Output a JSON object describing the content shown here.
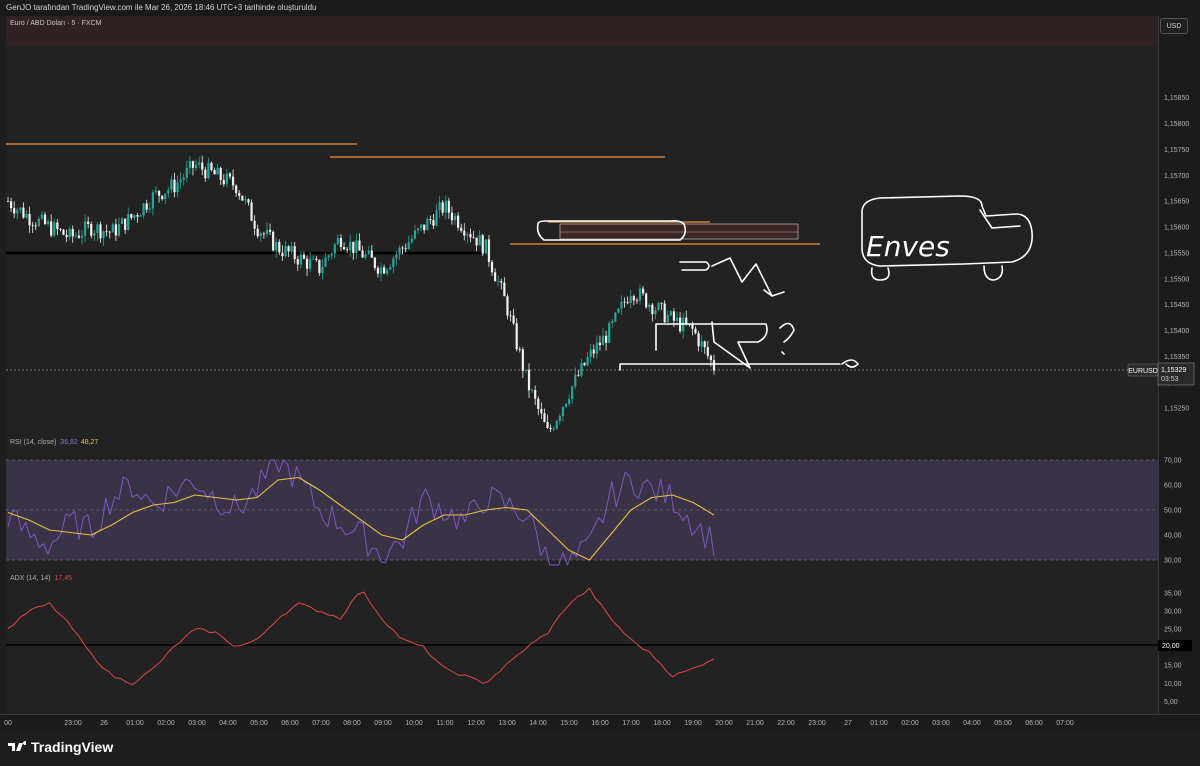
{
  "header": {
    "attribution": "GenJO tarafından TradingView.com ile Mar 26, 2026 18:46 UTC+3 tarihinde oluşturuldu",
    "symbol_title": "Euro / ABD Doları · 5 · FXCM",
    "currency": "USD"
  },
  "price_badge": {
    "symbol": "EURUSD",
    "price": "1,15329",
    "countdown": "03:53"
  },
  "annotation_text": "Enves",
  "indicators": {
    "rsi": {
      "name": "RSI (14, close)",
      "value": "36,82",
      "ma_value": "48,27"
    },
    "adx": {
      "name": "ADX (14, 14)",
      "value": "17,45",
      "level_label": "20,00"
    }
  },
  "brand": {
    "name": "TradingView"
  },
  "colors": {
    "bull": "#26a69a",
    "bear": "#f0f0f0",
    "resistance": "#f5913a",
    "rsi": "#7e57c2",
    "rsi_ma": "#e8c145",
    "adx": "#e04848",
    "rsi_band": "#3a3347"
  },
  "chart_data": [
    {
      "type": "candlestick",
      "title": "Euro / ABD Doları · 5 · FXCM",
      "ylim": [
        1.152,
        1.1595
      ],
      "y_ticks": [
        "1,15850",
        "1,15800",
        "1,15750",
        "1,15700",
        "1,15650",
        "1,15600",
        "1,15550",
        "1,15500",
        "1,15450",
        "1,15400",
        "1,15350",
        "1,15300",
        "1,15250"
      ],
      "x_ticks": [
        "00",
        "23:00",
        "26",
        "01:00",
        "02:00",
        "03:00",
        "04:00",
        "05:00",
        "06:00",
        "07:00",
        "08:00",
        "09:00",
        "10:00",
        "11:00",
        "12:00",
        "13:00",
        "14:00",
        "15:00",
        "16:00",
        "17:00",
        "18:00",
        "19:00",
        "20:00",
        "21:00",
        "22:00",
        "23:00",
        "27",
        "01:00",
        "02:00",
        "03:00",
        "04:00",
        "05:00",
        "06:00",
        "07:00"
      ],
      "close_path": [
        1.1565,
        1.1562,
        1.156,
        1.1558,
        1.156,
        1.1559,
        1.1562,
        1.1566,
        1.1568,
        1.1572,
        1.157,
        1.1568,
        1.156,
        1.1556,
        1.1554,
        1.1552,
        1.1558,
        1.1555,
        1.1552,
        1.1556,
        1.156,
        1.1564,
        1.156,
        1.1556,
        1.1545,
        1.153,
        1.152,
        1.1528,
        1.1535,
        1.154,
        1.1548,
        1.1545,
        1.1542,
        1.154,
        1.1533
      ],
      "last_price": 1.15329,
      "levels": [
        1.15704,
        1.15685,
        1.15525,
        1.15535,
        1.1557
      ]
    },
    {
      "type": "line",
      "title": "RSI (14, close)",
      "ylim": [
        25,
        75
      ],
      "y_ticks": [
        "70,00",
        "60,00",
        "50,00",
        "40,00",
        "30,00"
      ],
      "series": [
        {
          "name": "RSI",
          "values": [
            48,
            40,
            36,
            45,
            42,
            55,
            60,
            52,
            58,
            62,
            55,
            50,
            58,
            70,
            62,
            50,
            45,
            40,
            32,
            38,
            55,
            50,
            45,
            55,
            52,
            48,
            30,
            28,
            35,
            55,
            62,
            58,
            55,
            45,
            37
          ]
        },
        {
          "name": "MA",
          "values": [
            49,
            46,
            42,
            41,
            40,
            44,
            49,
            52,
            53,
            56,
            55,
            54,
            55,
            62,
            63,
            58,
            52,
            46,
            40,
            38,
            44,
            48,
            48,
            50,
            51,
            50,
            42,
            34,
            30,
            40,
            50,
            55,
            56,
            53,
            48
          ]
        }
      ]
    },
    {
      "type": "line",
      "title": "ADX (14, 14)",
      "ylim": [
        2,
        38
      ],
      "y_ticks": [
        "35,00",
        "30,00",
        "25,00",
        "20,00",
        "15,00",
        "10,00",
        "5,00"
      ],
      "series": [
        {
          "name": "ADX",
          "values": [
            25,
            30,
            32,
            26,
            18,
            12,
            10,
            14,
            20,
            25,
            24,
            20,
            22,
            28,
            32,
            30,
            28,
            36,
            28,
            22,
            20,
            14,
            12,
            10,
            15,
            20,
            24,
            32,
            36,
            28,
            22,
            18,
            12,
            14,
            17
          ]
        }
      ],
      "level": 20
    }
  ]
}
